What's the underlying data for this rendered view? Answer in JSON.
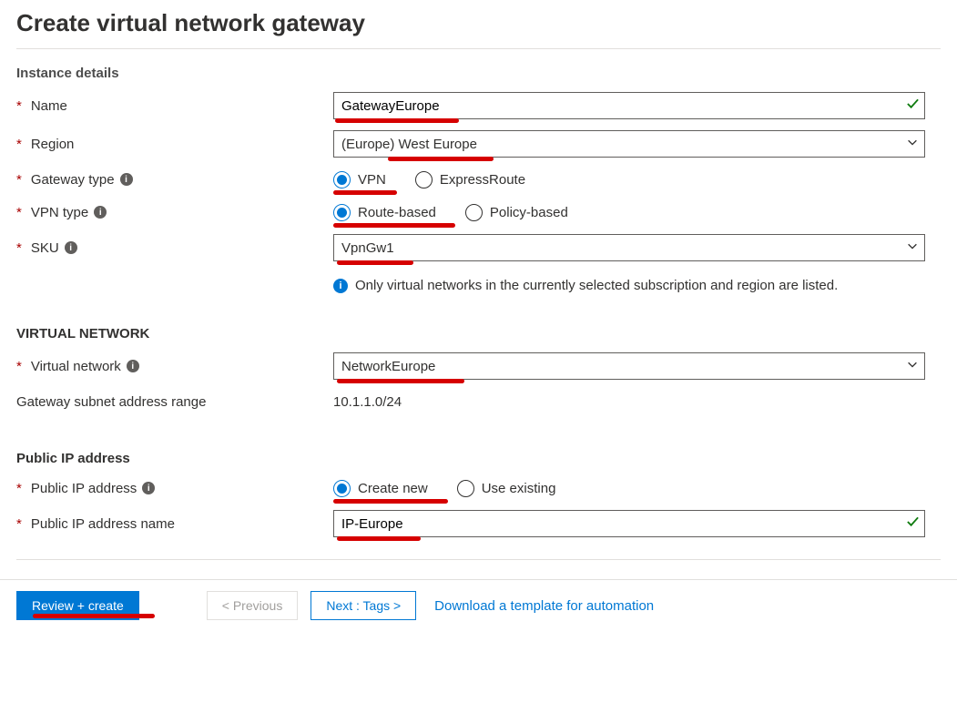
{
  "page_title": "Create virtual network gateway",
  "section_instance": "Instance details",
  "labels": {
    "name": "Name",
    "region": "Region",
    "gateway_type": "Gateway type",
    "vpn_type": "VPN type",
    "sku": "SKU",
    "virtual_network": "Virtual network",
    "gateway_subnet": "Gateway subnet address range",
    "public_ip": "Public IP address",
    "public_ip_name": "Public IP address name"
  },
  "values": {
    "name": "GatewayEurope",
    "region": "(Europe) West Europe",
    "gateway_type_options": [
      "VPN",
      "ExpressRoute"
    ],
    "gateway_type_selected": "VPN",
    "vpn_type_options": [
      "Route-based",
      "Policy-based"
    ],
    "vpn_type_selected": "Route-based",
    "sku": "VpnGw1",
    "virtual_network": "NetworkEurope",
    "gateway_subnet": "10.1.1.0/24",
    "public_ip_options": [
      "Create new",
      "Use existing"
    ],
    "public_ip_selected": "Create new",
    "public_ip_name": "IP-Europe"
  },
  "section_vnet": "VIRTUAL NETWORK",
  "section_publicip": "Public IP address",
  "info_vnet": "Only virtual networks in the currently selected subscription and region are listed.",
  "footer": {
    "review": "Review + create",
    "previous": "< Previous",
    "next": "Next : Tags >",
    "download": "Download a template for automation"
  }
}
